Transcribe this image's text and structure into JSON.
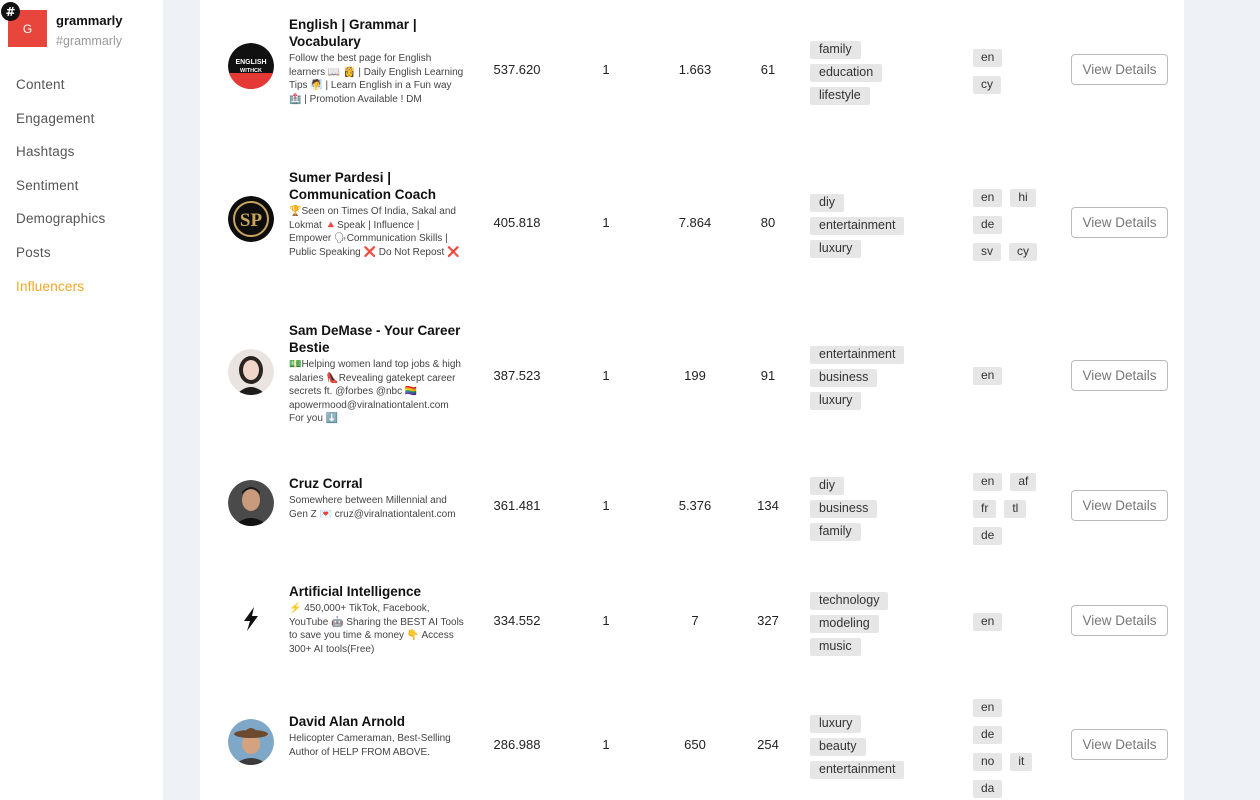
{
  "brand": {
    "initial": "G",
    "badge": "#",
    "name": "grammarly",
    "handle": "#grammarly"
  },
  "nav": [
    "Content",
    "Engagement",
    "Hashtags",
    "Sentiment",
    "Demographics",
    "Posts",
    "Influencers"
  ],
  "active_nav": "Influencers",
  "accent_color": "#f5a623",
  "view_details_label": "View Details",
  "influencers": [
    {
      "name": "English | Grammar | Vocabulary",
      "bio": "Follow the best page for English learners 📖 👸 | Daily English Learning Tips 🧖 | Learn English in a Fun way 🏥 | Promotion Available ! DM",
      "followers": "537.620",
      "col2": "1",
      "engagement": "1.663",
      "posts": "61",
      "categories": [
        "family",
        "education",
        "lifestyle"
      ],
      "languages": [
        [
          "en"
        ],
        [
          "cy"
        ]
      ],
      "avatar_icon": "english-withck-logo-icon"
    },
    {
      "name": "Sumer Pardesi | Communication Coach",
      "bio": "🏆Seen on Times Of India, Sakal and Lokmat 🔺Speak | Influence | Empower 🗣Communication Skills | Public Speaking ❌ Do Not Repost ❌",
      "followers": "405.818",
      "col2": "1",
      "engagement": "7.864",
      "posts": "80",
      "categories": [
        "diy",
        "entertainment",
        "luxury"
      ],
      "languages": [
        [
          "en",
          "hi"
        ],
        [
          "de"
        ],
        [
          "sv",
          "cy"
        ]
      ],
      "avatar_icon": "sp-monogram-logo-icon"
    },
    {
      "name": "Sam DeMase - Your Career Bestie",
      "bio": "💵Helping women land top jobs & high salaries 👠Revealing gatekept career secrets ft. @forbes @nbc 🏳️‍🌈 apowermood@viralnationtalent.com For you ⬇️",
      "followers": "387.523",
      "col2": "1",
      "engagement": "199",
      "posts": "91",
      "categories": [
        "entertainment",
        "business",
        "luxury"
      ],
      "languages": [
        [
          "en"
        ]
      ],
      "avatar_icon": "woman-portrait-icon"
    },
    {
      "name": "Cruz Corral",
      "bio": "Somewhere between Millennial and Gen Z 💌 cruz@viralnationtalent.com",
      "followers": "361.481",
      "col2": "1",
      "engagement": "5.376",
      "posts": "134",
      "categories": [
        "diy",
        "business",
        "family"
      ],
      "languages": [
        [
          "en",
          "af"
        ],
        [
          "fr",
          "tl"
        ],
        [
          "de"
        ]
      ],
      "avatar_icon": "man-portrait-icon"
    },
    {
      "name": "Artificial Intelligence",
      "bio": "⚡ 450,000+ TikTok, Facebook, YouTube 🤖 Sharing the BEST AI Tools to save you time & money 👇 Access 300+ AI tools(Free)",
      "followers": "334.552",
      "col2": "1",
      "engagement": "7",
      "posts": "327",
      "categories": [
        "technology",
        "modeling",
        "music"
      ],
      "languages": [
        [
          "en"
        ]
      ],
      "avatar_icon": "lightning-bolt-icon"
    },
    {
      "name": "David Alan Arnold",
      "bio": "Helicopter Cameraman, Best-Selling Author of HELP FROM ABOVE.",
      "followers": "286.988",
      "col2": "1",
      "engagement": "650",
      "posts": "254",
      "categories": [
        "luxury",
        "beauty",
        "entertainment"
      ],
      "languages": [
        [
          "en"
        ],
        [
          "de"
        ],
        [
          "no",
          "it"
        ],
        [
          "da"
        ]
      ],
      "avatar_icon": "man-cowboy-hat-portrait-icon"
    }
  ]
}
